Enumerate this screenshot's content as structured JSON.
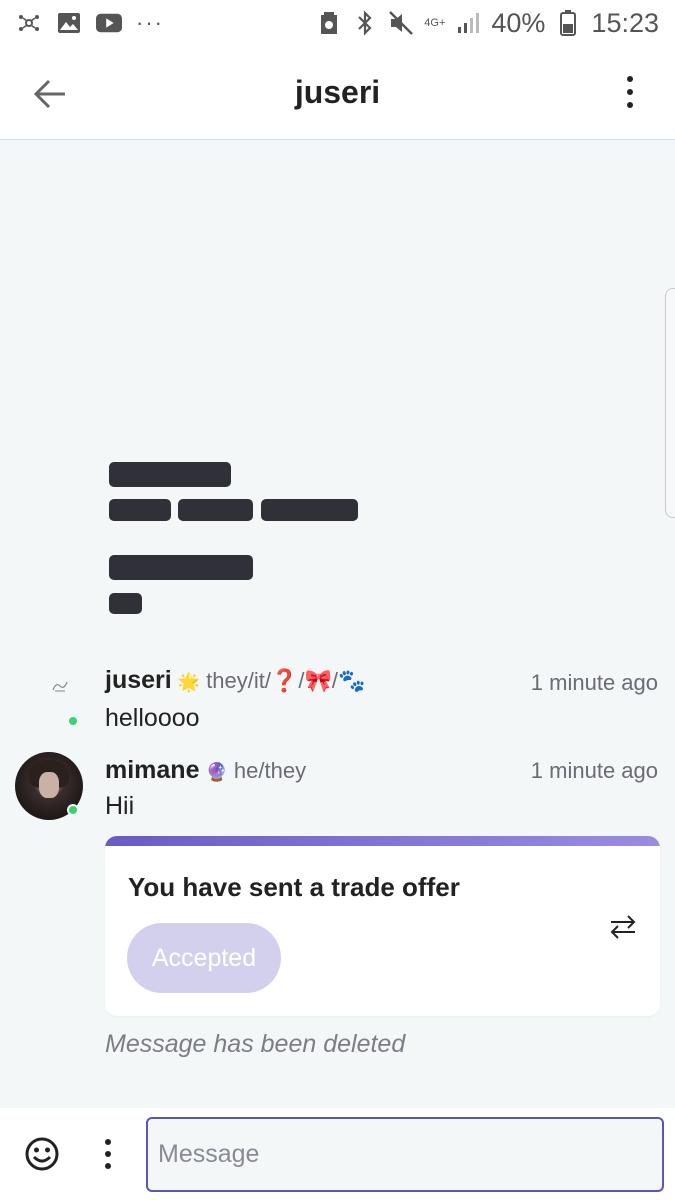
{
  "status_bar": {
    "left_icons": [
      "network-icon",
      "gallery-icon",
      "youtube-icon",
      "more-notifications-icon"
    ],
    "right_icons": [
      "storage-icon",
      "bluetooth-icon",
      "mute-icon",
      "network-4g-icon",
      "signal-icon",
      "battery-icon"
    ],
    "network_label": "4G+",
    "battery": "40%",
    "time": "15:23"
  },
  "app_bar": {
    "title": "juseri"
  },
  "messages": [
    {
      "username": "juseri",
      "pronouns": "they/it/❓/🎀/🐾",
      "badge": "🌟",
      "time": "1 minute ago",
      "text": "helloooo"
    },
    {
      "username": "mimane",
      "pronouns": "he/they",
      "badge": "🔮",
      "time": "1 minute ago",
      "text": "Hii"
    }
  ],
  "trade_card": {
    "title": "You have sent a trade offer",
    "status_button": "Accepted"
  },
  "deleted_message": "Message has been deleted",
  "composer": {
    "placeholder": "Message"
  },
  "colors": {
    "accent": "#5e55b3",
    "online": "#3ecf73",
    "accepted_bg": "#d3d0ee"
  }
}
